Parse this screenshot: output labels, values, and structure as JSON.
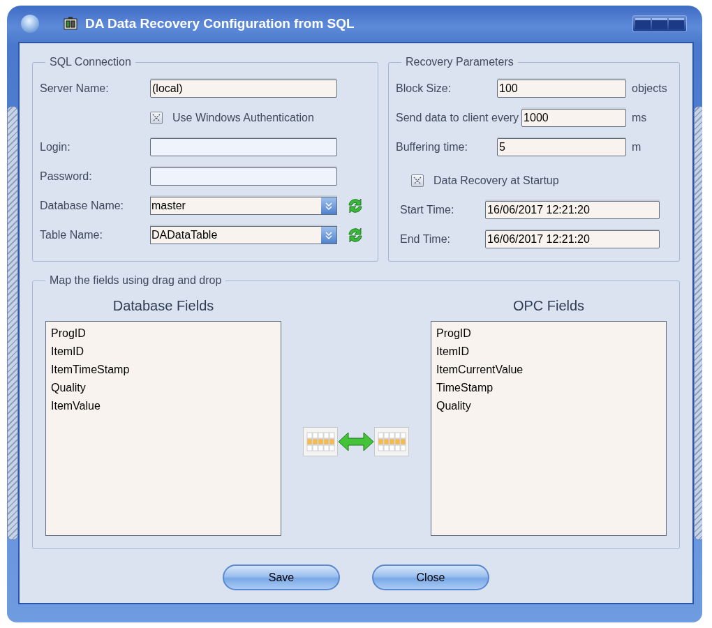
{
  "window": {
    "title": "DA Data Recovery Configuration from SQL"
  },
  "sql_connection": {
    "title": "SQL Connection",
    "fields": [
      {
        "kind": "text",
        "label": "Server Name:",
        "value": "(local)",
        "disabled": false
      },
      {
        "kind": "checkbox",
        "label": "Use Windows Authentication",
        "checked": true
      },
      {
        "kind": "text",
        "label": "Login:",
        "disabled": true
      },
      {
        "kind": "text",
        "label": "Password:",
        "disabled": true
      },
      {
        "kind": "dropdown",
        "label": "Database Name:",
        "value": "master"
      },
      {
        "kind": "dropdown",
        "label": "Table Name:",
        "value": "DADataTable"
      }
    ]
  },
  "recovery_parameters": {
    "title": "Recovery Parameters",
    "fields": [
      {
        "kind": "number",
        "label": "Block Size:",
        "value": "100",
        "unit": "objects"
      },
      {
        "kind": "number",
        "label": "Send data to client every",
        "value": "1000",
        "unit": "ms"
      },
      {
        "kind": "number",
        "label": "Buffering time:",
        "value": "5",
        "unit": "m"
      },
      {
        "kind": "checkbox",
        "label": "Data Recovery at Startup",
        "checked": true
      },
      {
        "kind": "datetime",
        "label": "Start Time:",
        "value": "16/06/2017 12:21:20"
      },
      {
        "kind": "datetime",
        "label": "End Time:",
        "value": "16/06/2017 12:21:20"
      }
    ]
  },
  "mapping": {
    "title": "Map the fields using drag and drop",
    "lists": [
      {
        "title": "Database Fields",
        "items": [
          "ProgID",
          "ItemID",
          "ItemTimeStamp",
          "Quality",
          "ItemValue"
        ]
      },
      {
        "title": "OPC Fields",
        "items": [
          "ProgID",
          "ItemID",
          "ItemCurrentValue",
          "TimeStamp",
          "Quality"
        ]
      }
    ]
  },
  "buttons": [
    "Save",
    "Close"
  ]
}
